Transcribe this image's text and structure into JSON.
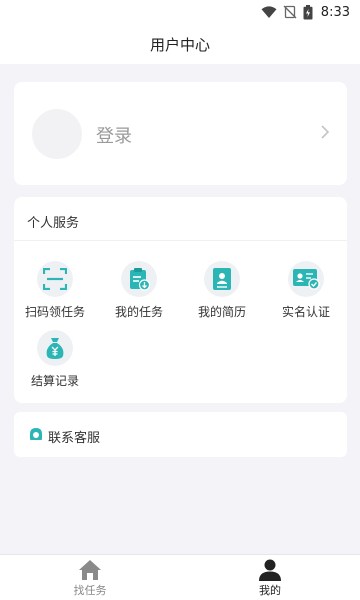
{
  "status_bar": {
    "time": "8:33"
  },
  "header": {
    "title": "用户中心"
  },
  "login": {
    "label": "登录"
  },
  "services": {
    "title": "个人服务",
    "items": [
      {
        "label": "扫码领任务",
        "icon": "scan-icon"
      },
      {
        "label": "我的任务",
        "icon": "task-clipboard-icon"
      },
      {
        "label": "我的简历",
        "icon": "resume-icon"
      },
      {
        "label": "实名认证",
        "icon": "id-verify-icon"
      },
      {
        "label": "结算记录",
        "icon": "money-bag-icon"
      }
    ]
  },
  "contact": {
    "label": "联系客服",
    "icon": "customer-service-icon"
  },
  "tabbar": {
    "items": [
      {
        "label": "找任务",
        "icon": "home-icon"
      },
      {
        "label": "我的",
        "icon": "user-icon"
      }
    ]
  },
  "colors": {
    "accent": "#2bb5b5",
    "background": "#f3f3f8"
  }
}
